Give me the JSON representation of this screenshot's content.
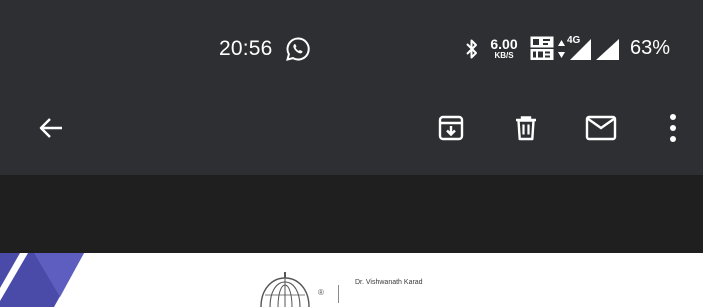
{
  "status_bar": {
    "time": "20:56",
    "net_speed_value": "6.00",
    "net_speed_unit": "KB/S",
    "network_type": "4G",
    "battery_percent": "63%",
    "icons": [
      "whatsapp-icon",
      "bluetooth-icon",
      "volte-icon",
      "data-activity-icon",
      "signal-icon",
      "signal-icon"
    ]
  },
  "toolbar": {
    "icons": [
      "back-arrow-icon",
      "archive-icon",
      "delete-icon",
      "mark-unread-icon",
      "more-vert-icon"
    ]
  },
  "email_body": {
    "logo_text": "Dr. Vishwanath Karad",
    "registered_mark": "®"
  },
  "colors": {
    "top_background": "#2d2f32",
    "strip_background": "#1f1f1f",
    "content_background": "#ffffff",
    "accent_purple": "#4a4aa8"
  }
}
